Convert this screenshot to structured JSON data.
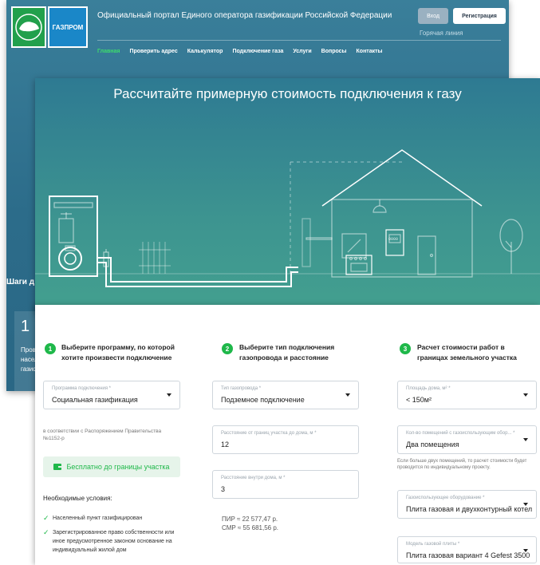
{
  "header": {
    "portal_title": "Официальный портал Единого оператора газификации Российской Федерации",
    "gazprom_logo": "ГАЗПРОМ",
    "login_label": "Вход",
    "register_label": "Регистрация",
    "hotline_label": "Горячая линия",
    "nav": [
      "Главная",
      "Проверить адрес",
      "Калькулятор",
      "Подключение газа",
      "Услуги",
      "Вопросы",
      "Контакты"
    ]
  },
  "background_page": {
    "steps_heading": "Шаги д",
    "step1_number": "1",
    "step1_text": "Прове насел газиф"
  },
  "calculator": {
    "title": "Рассчитайте примерную стоимость подключения к газу",
    "house_meter_label": "0000"
  },
  "panel": {
    "col1": {
      "number": "1",
      "heading": "Выберите программу, по которой хотите произвести подключение",
      "program_label": "Программа подключения *",
      "program_value": "Социальная газификация",
      "note": "в соответствии с Распоряжением Правительства №1152-р",
      "free_button": "Бесплатно до границы участка",
      "conditions_heading": "Необходимые условия:",
      "conditions": [
        "Населенный пункт газифицирован",
        "Зарегистрированное право собственности или иное предусмотренное законом основание на индивидуальный жилой дом"
      ]
    },
    "col2": {
      "number": "2",
      "heading": "Выберите тип подключения газопровода и расстояние",
      "pipe_label": "Тип газопровода *",
      "pipe_value": "Подземное подключение",
      "dist_border_label": "Расстояние от границ участка до дома, м *",
      "dist_border_value": "12",
      "dist_inside_label": "Расстояние внутри дома, м *",
      "dist_inside_value": "3",
      "pir": "ПИР ≈ 22 577,47 р.",
      "smr": "СМР ≈ 55 681,56 р."
    },
    "col3": {
      "number": "3",
      "heading": "Расчет стоимости работ в границах земельного участка",
      "area_label": "Площадь дома, м² *",
      "area_value": "< 150м²",
      "rooms_label": "Кол-во помещений с газоиспользующим обор... *",
      "rooms_value": "Два помещения",
      "rooms_note": "Если больше двух помещений, то расчет стоимости будет проводится по индивидуальному проекту.",
      "equipment_label": "Газоиспользующее оборудование *",
      "equipment_value": "Плита газовая и двухконтурный котел",
      "stove_label": "Модель газовой плиты *",
      "stove_value": "Плита газовая вариант 4 Gefest 3500"
    }
  },
  "colors": {
    "accent_green": "#1fb84a",
    "header_blue": "#2c6c8a",
    "calc_teal": "#3d9490"
  }
}
